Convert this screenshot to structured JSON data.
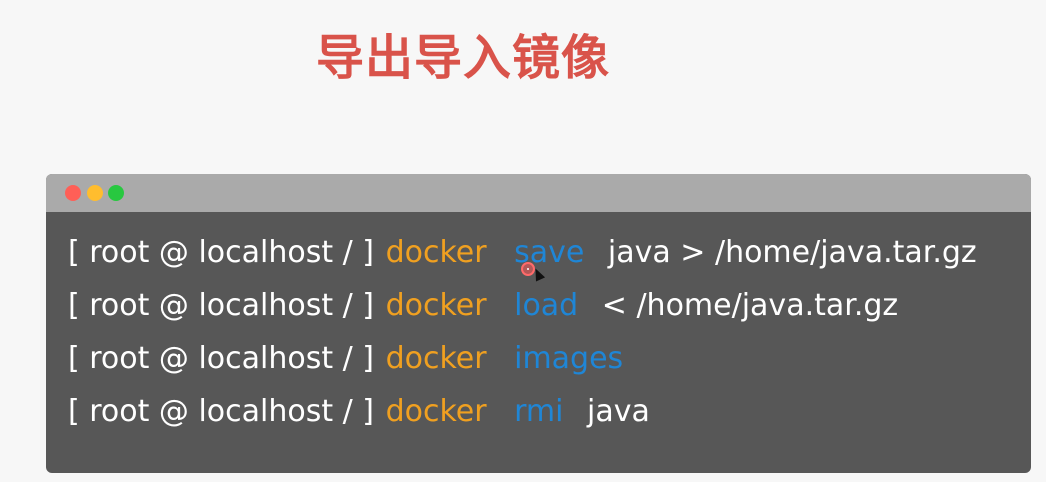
{
  "slide": {
    "title": "导出导入镜像"
  },
  "terminal": {
    "colors": {
      "command": "#f0a020",
      "subcommand": "#1f86d6",
      "text": "#ffffff",
      "background": "#575757",
      "titlebar": "#aaaaaa"
    },
    "lines": [
      {
        "prompt": "[ root @ localhost / ]",
        "cmd": "docker",
        "sub": "save",
        "args": "java > /home/java.tar.gz"
      },
      {
        "prompt": "[ root @ localhost / ]",
        "cmd": "docker",
        "sub": "load",
        "args": "< /home/java.tar.gz"
      },
      {
        "prompt": "[ root @ localhost / ]",
        "cmd": "docker",
        "sub": "images",
        "args": ""
      },
      {
        "prompt": "[ root @ localhost / ]",
        "cmd": "docker",
        "sub": "rmi",
        "args": "java"
      }
    ]
  }
}
